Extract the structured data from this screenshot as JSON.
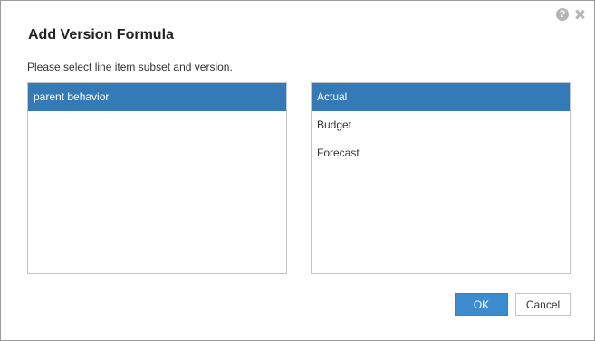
{
  "dialog": {
    "title": "Add Version Formula",
    "instruction": "Please select line item subset and version.",
    "help_icon_glyph": "?"
  },
  "line_item_subsets": {
    "items": [
      {
        "label": "parent behavior",
        "selected": true
      }
    ]
  },
  "versions": {
    "items": [
      {
        "label": "Actual",
        "selected": true
      },
      {
        "label": "Budget",
        "selected": false
      },
      {
        "label": "Forecast",
        "selected": false
      }
    ]
  },
  "buttons": {
    "ok_label": "OK",
    "cancel_label": "Cancel"
  },
  "colors": {
    "selection": "#337ab7",
    "primary_button": "#3d8ccf"
  },
  "icons": [
    "help-icon",
    "close-icon"
  ]
}
